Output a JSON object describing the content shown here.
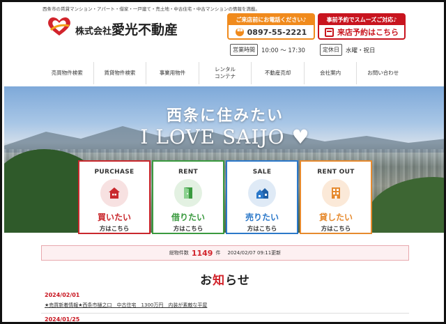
{
  "header": {
    "tagline": "西条市の賃貸マンション・アパート・借家・一戸建て・売土地・中古住宅・中古マンションの情報を満載。",
    "company_prefix": "株式会社",
    "company_name": "愛光不動産",
    "phone_cta": {
      "heading": "ご来店前にお電話ください♪",
      "number": "0897-55-2221"
    },
    "visit_cta": {
      "heading": "事前予約でスムーズご対応♪",
      "label": "来店予約はこちら"
    },
    "hours": {
      "label": "営業時間",
      "value": "10:00 ～ 17:30"
    },
    "closed": {
      "label": "定休日",
      "value": "水曜・祝日"
    }
  },
  "nav": [
    {
      "label": "売買物件検索"
    },
    {
      "label": "賃貸物件検索"
    },
    {
      "label": "事業用物件"
    },
    {
      "label": "レンタル\nコンテナ"
    },
    {
      "label": "不動産売却"
    },
    {
      "label": "会社案内"
    },
    {
      "label": "お問い合わせ"
    }
  ],
  "hero": {
    "title": "西条に住みたい",
    "subtitle": "I LOVE SAIJO",
    "heart": "♥"
  },
  "cards": [
    {
      "en": "PURCHASE",
      "jp": "買いたい",
      "sub": "方はこちら",
      "color": "#c9282d"
    },
    {
      "en": "RENT",
      "jp": "借りたい",
      "sub": "方はこちら",
      "color": "#3a9a3f"
    },
    {
      "en": "SALE",
      "jp": "売りたい",
      "sub": "方はこちら",
      "color": "#2b78c9"
    },
    {
      "en": "RENT OUT",
      "jp": "貸したい",
      "sub": "方はこちら",
      "color": "#e68a2e"
    }
  ],
  "stats": {
    "prefix": "総物件数",
    "count": "1149",
    "unit": "件",
    "updated": "2024/02/07 09:11更新"
  },
  "news": {
    "title_pre": "お",
    "title_accent": "知",
    "title_post": "らせ",
    "items": [
      {
        "date": "2024/02/01",
        "text": "★売買新着情報★西条市樋之口　中古住宅　1300万円　内装が素敵な平屋"
      },
      {
        "date": "2024/01/25",
        "text": ""
      }
    ]
  }
}
